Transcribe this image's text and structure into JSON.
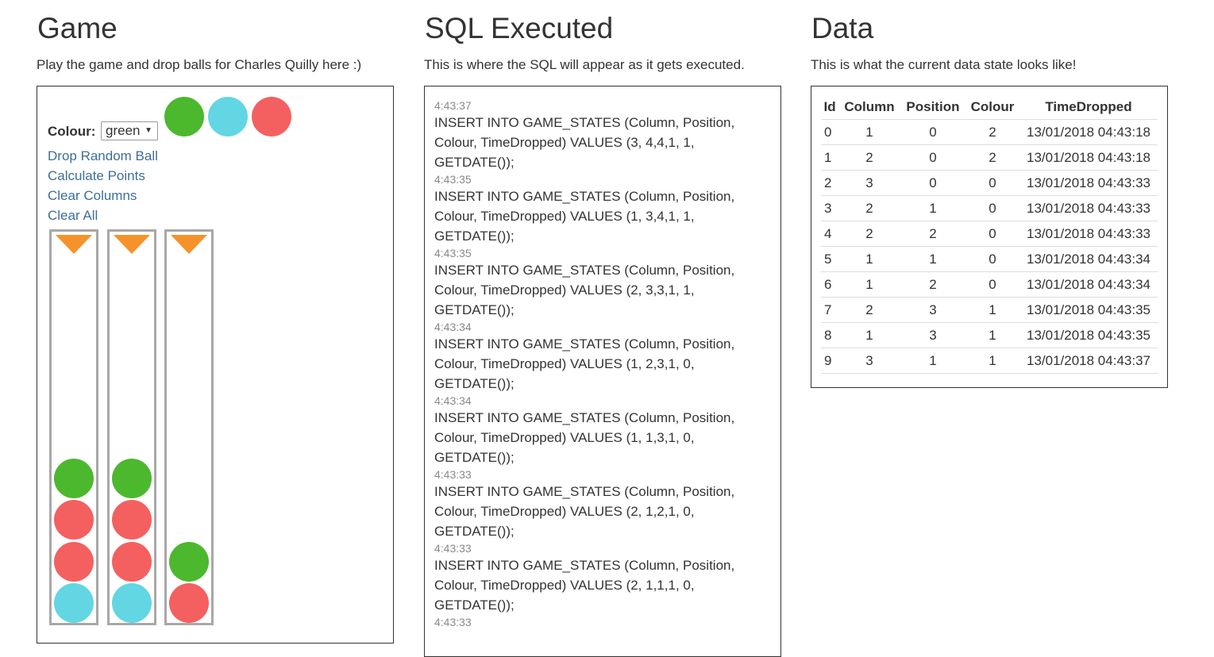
{
  "game": {
    "title": "Game",
    "subtitle": "Play the game and drop balls for Charles Quilly here :)",
    "colour_label": "Colour:",
    "colour_selected": "green",
    "palette": [
      "#4cb82e",
      "#62d6e3",
      "#f4605f"
    ],
    "links": [
      "Drop Random Ball",
      "Calculate Points",
      "Clear Columns",
      "Clear All"
    ],
    "arrow_color": "#f5922a",
    "columns": [
      [
        "green",
        "red",
        "red",
        "cyan"
      ],
      [
        "green",
        "red",
        "red",
        "cyan"
      ],
      [
        "green",
        "red"
      ]
    ],
    "colors": {
      "green": "#4cb82e",
      "cyan": "#62d6e3",
      "red": "#f4605f"
    }
  },
  "sql": {
    "title": "SQL Executed",
    "subtitle": "This is where the SQL will appear as it gets executed.",
    "entries": [
      {
        "time": "4:43:37",
        "query": "INSERT INTO GAME_STATES (Column, Position, Colour, TimeDropped) VALUES (3, 4,4,1, 1, GETDATE());"
      },
      {
        "time": "4:43:35",
        "query": "INSERT INTO GAME_STATES (Column, Position, Colour, TimeDropped) VALUES (1, 3,4,1, 1, GETDATE());"
      },
      {
        "time": "4:43:35",
        "query": "INSERT INTO GAME_STATES (Column, Position, Colour, TimeDropped) VALUES (2, 3,3,1, 1, GETDATE());"
      },
      {
        "time": "4:43:34",
        "query": "INSERT INTO GAME_STATES (Column, Position, Colour, TimeDropped) VALUES (1, 2,3,1, 0, GETDATE());"
      },
      {
        "time": "4:43:34",
        "query": "INSERT INTO GAME_STATES (Column, Position, Colour, TimeDropped) VALUES (1, 1,3,1, 0, GETDATE());"
      },
      {
        "time": "4:43:33",
        "query": "INSERT INTO GAME_STATES (Column, Position, Colour, TimeDropped) VALUES (2, 1,2,1, 0, GETDATE());"
      },
      {
        "time": "4:43:33",
        "query": "INSERT INTO GAME_STATES (Column, Position, Colour, TimeDropped) VALUES (2, 1,1,1, 0, GETDATE());"
      },
      {
        "time": "4:43:33",
        "query": ""
      }
    ]
  },
  "data": {
    "title": "Data",
    "subtitle": "This is what the current data state looks like!",
    "headers": [
      "Id",
      "Column",
      "Position",
      "Colour",
      "TimeDropped"
    ],
    "rows": [
      [
        "0",
        "1",
        "0",
        "2",
        "13/01/2018 04:43:18"
      ],
      [
        "1",
        "2",
        "0",
        "2",
        "13/01/2018 04:43:18"
      ],
      [
        "2",
        "3",
        "0",
        "0",
        "13/01/2018 04:43:33"
      ],
      [
        "3",
        "2",
        "1",
        "0",
        "13/01/2018 04:43:33"
      ],
      [
        "4",
        "2",
        "2",
        "0",
        "13/01/2018 04:43:33"
      ],
      [
        "5",
        "1",
        "1",
        "0",
        "13/01/2018 04:43:34"
      ],
      [
        "6",
        "1",
        "2",
        "0",
        "13/01/2018 04:43:34"
      ],
      [
        "7",
        "2",
        "3",
        "1",
        "13/01/2018 04:43:35"
      ],
      [
        "8",
        "1",
        "3",
        "1",
        "13/01/2018 04:43:35"
      ],
      [
        "9",
        "3",
        "1",
        "1",
        "13/01/2018 04:43:37"
      ]
    ]
  }
}
